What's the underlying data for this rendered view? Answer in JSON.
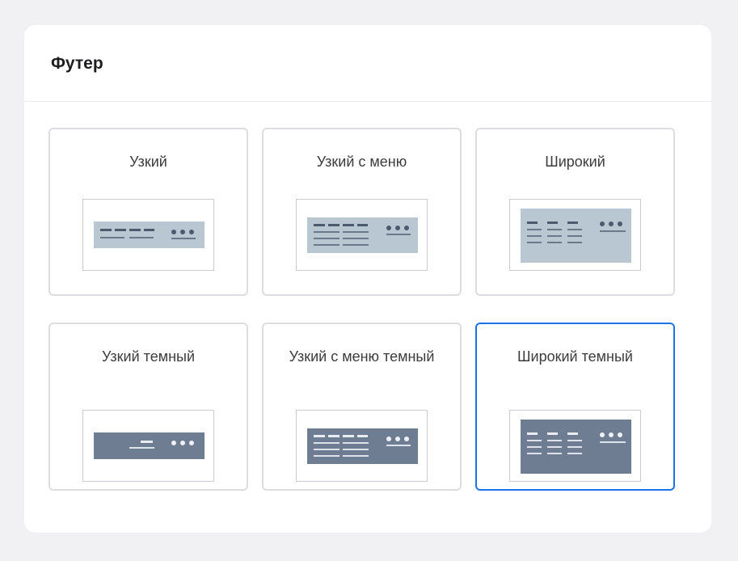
{
  "section": {
    "title": "Футер"
  },
  "options": [
    {
      "label": "Узкий",
      "variant": "narrow",
      "theme": "light",
      "selected": false
    },
    {
      "label": "Узкий с меню",
      "variant": "narrow-menu",
      "theme": "light",
      "selected": false
    },
    {
      "label": "Широкий",
      "variant": "wide",
      "theme": "light",
      "selected": false
    },
    {
      "label": "Узкий темный",
      "variant": "narrow",
      "theme": "dark",
      "selected": false
    },
    {
      "label": "Узкий с меню темный",
      "variant": "narrow-menu",
      "theme": "dark",
      "selected": false
    },
    {
      "label": "Широкий темный",
      "variant": "wide",
      "theme": "dark",
      "selected": true
    }
  ],
  "colors": {
    "selected_border": "#1a73e8",
    "card_border": "#dcdde0",
    "light_footer": "#b9c7d3",
    "dark_footer": "#6f7d92"
  }
}
